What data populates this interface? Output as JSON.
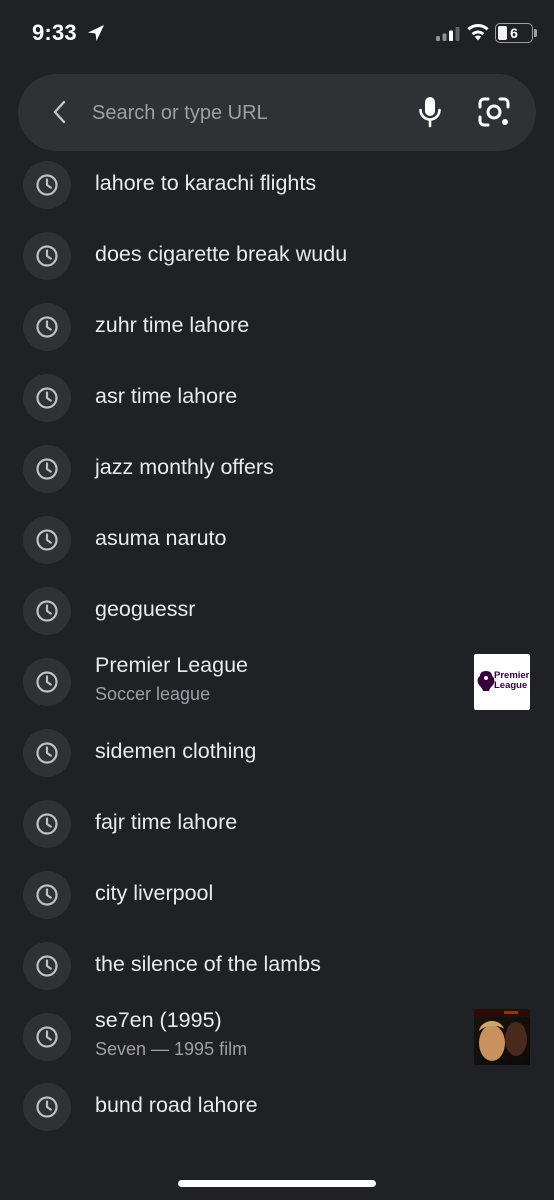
{
  "status_bar": {
    "time": "9:33",
    "battery_level": "6",
    "icons": [
      "location-arrow-icon",
      "signal-icon",
      "wifi-icon",
      "battery-icon"
    ]
  },
  "search_bar": {
    "placeholder": "Search or type URL",
    "value": "",
    "icons": [
      "back-chevron-icon",
      "microphone-icon",
      "lens-camera-icon"
    ]
  },
  "suggestions": [
    {
      "title": "lahore to karachi flights"
    },
    {
      "title": "does cigarette break wudu"
    },
    {
      "title": "zuhr time lahore"
    },
    {
      "title": "asr time lahore"
    },
    {
      "title": "jazz monthly offers"
    },
    {
      "title": "asuma naruto"
    },
    {
      "title": "geoguessr"
    },
    {
      "title": "Premier League",
      "subtitle": "Soccer league",
      "thumbnail": "premier-league-logo",
      "thumbnail_text": "Premier League"
    },
    {
      "title": "sidemen clothing"
    },
    {
      "title": "fajr time lahore"
    },
    {
      "title": "city liverpool"
    },
    {
      "title": "the silence of the lambs"
    },
    {
      "title": "se7en (1995)",
      "subtitle": "Seven — 1995 film",
      "thumbnail": "movie-poster"
    },
    {
      "title": "bund road lahore"
    }
  ],
  "colors": {
    "background": "#202124",
    "surface": "#303134",
    "text_primary": "#e8eaed",
    "text_secondary": "#9aa0a6",
    "premier_league_purple": "#37003c"
  }
}
